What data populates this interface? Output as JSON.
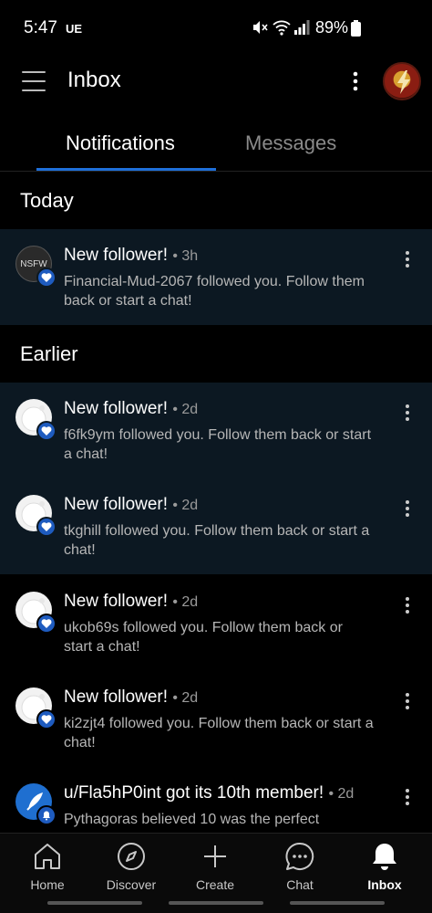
{
  "status_bar": {
    "time": "5:47",
    "carrier": "UE",
    "battery_percent": "89%"
  },
  "header": {
    "title": "Inbox"
  },
  "tabs": [
    {
      "label": "Notifications",
      "active": true
    },
    {
      "label": "Messages",
      "active": false
    }
  ],
  "sections": {
    "today": "Today",
    "earlier": "Earlier"
  },
  "notifications": [
    {
      "title": "New follower!",
      "time": "• 3h",
      "body": "Financial-Mud-2067 followed you. Follow them back or start a chat!",
      "avatar": "NSFW",
      "unread": true
    },
    {
      "title": "New follower!",
      "time": "• 2d",
      "body": "f6fk9ym followed you. Follow them back or start a chat!",
      "avatar": "snoo",
      "unread": true
    },
    {
      "title": "New follower!",
      "time": "• 2d",
      "body": "tkghill followed you. Follow them back or start a chat!",
      "avatar": "snoo",
      "unread": true
    },
    {
      "title": "New follower!",
      "time": "• 2d",
      "body": "ukob69s followed you. Follow them back or start a chat!",
      "avatar": "snoo",
      "unread": false
    },
    {
      "title": "New follower!",
      "time": "• 2d",
      "body": "ki2zjt4 followed you. Follow them back or start a chat!",
      "avatar": "snoo",
      "unread": false
    },
    {
      "title": "u/Fla5hP0int got its 10th member!",
      "time": "• 2d",
      "body": "Pythagoras believed 10 was the perfect",
      "avatar": "community",
      "unread": false
    }
  ],
  "bottom_nav": [
    {
      "label": "Home",
      "icon": "home-icon"
    },
    {
      "label": "Discover",
      "icon": "compass-icon"
    },
    {
      "label": "Create",
      "icon": "plus-icon"
    },
    {
      "label": "Chat",
      "icon": "chat-icon"
    },
    {
      "label": "Inbox",
      "icon": "bell-icon",
      "active": true
    }
  ],
  "colors": {
    "accent": "#1e6fd9",
    "unread_bg": "#0c1822",
    "background": "#000000"
  }
}
